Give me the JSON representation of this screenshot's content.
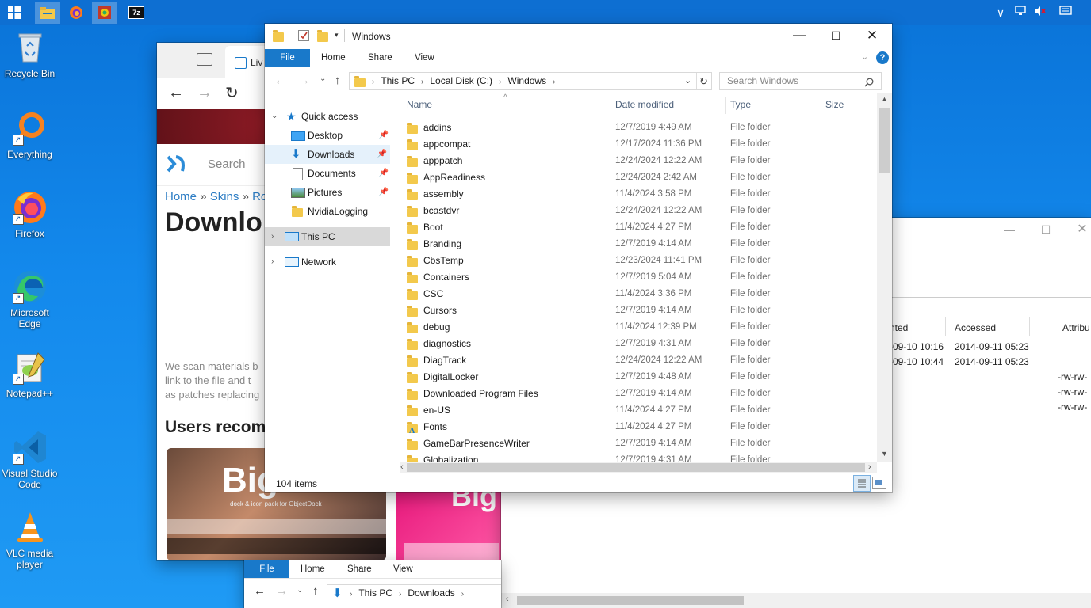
{
  "desktop_icons": [
    {
      "label": "Recycle Bin",
      "icon": "recycle-bin-icon"
    },
    {
      "label": "Everything",
      "icon": "everything-search-icon"
    },
    {
      "label": "Firefox",
      "icon": "firefox-icon"
    },
    {
      "label": "Microsoft Edge",
      "icon": "edge-icon"
    },
    {
      "label": "Notepad++",
      "icon": "notepadpp-icon"
    },
    {
      "label": "Visual Studio Code",
      "icon": "vscode-icon"
    },
    {
      "label": "VLC media player",
      "icon": "vlc-icon"
    }
  ],
  "taskbar": {
    "pinned": [
      "windows-start-icon",
      "file-explorer-icon",
      "firefox-icon",
      "app-icon",
      "7zip-icon"
    ],
    "zip_label": "7z"
  },
  "browser": {
    "tab_label": "Liv",
    "search_placeholder": "Search",
    "breadcrumb": {
      "home": "Home",
      "sep": "»",
      "skins": "Skins",
      "rest": "Ro"
    },
    "heading": "Downlo",
    "body_lines": [
      "We scan materials b",
      "link to the file and t",
      "as patches replacing"
    ],
    "users_heading": "Users recomn",
    "thumb_text_1": "Big",
    "thumb_text_2": "Big",
    "thumb_caption": "dock & icon pack for ObjectDock"
  },
  "explorer": {
    "title": "Windows",
    "ribbon": {
      "file": "File",
      "home": "Home",
      "share": "Share",
      "view": "View"
    },
    "address": [
      "This PC",
      "Local Disk (C:)",
      "Windows"
    ],
    "search_placeholder": "Search Windows",
    "nav": {
      "quick_access": "Quick access",
      "items": [
        {
          "label": "Desktop",
          "icon": "desktop-icon",
          "pinned": true
        },
        {
          "label": "Downloads",
          "icon": "downloads-icon",
          "pinned": true
        },
        {
          "label": "Documents",
          "icon": "documents-icon",
          "pinned": true
        },
        {
          "label": "Pictures",
          "icon": "pictures-icon",
          "pinned": true
        },
        {
          "label": "NvidiaLogging",
          "icon": "folder-icon",
          "pinned": false
        }
      ],
      "this_pc": "This PC",
      "network": "Network"
    },
    "columns": {
      "name": "Name",
      "date": "Date modified",
      "type": "Type",
      "size": "Size"
    },
    "files": [
      {
        "name": "addins",
        "date": "12/7/2019 4:49 AM",
        "type": "File folder"
      },
      {
        "name": "appcompat",
        "date": "12/17/2024 11:36 PM",
        "type": "File folder"
      },
      {
        "name": "apppatch",
        "date": "12/24/2024 12:22 AM",
        "type": "File folder"
      },
      {
        "name": "AppReadiness",
        "date": "12/24/2024 2:42 AM",
        "type": "File folder"
      },
      {
        "name": "assembly",
        "date": "11/4/2024 3:58 PM",
        "type": "File folder"
      },
      {
        "name": "bcastdvr",
        "date": "12/24/2024 12:22 AM",
        "type": "File folder"
      },
      {
        "name": "Boot",
        "date": "11/4/2024 4:27 PM",
        "type": "File folder"
      },
      {
        "name": "Branding",
        "date": "12/7/2019 4:14 AM",
        "type": "File folder"
      },
      {
        "name": "CbsTemp",
        "date": "12/23/2024 11:41 PM",
        "type": "File folder"
      },
      {
        "name": "Containers",
        "date": "12/7/2019 5:04 AM",
        "type": "File folder"
      },
      {
        "name": "CSC",
        "date": "11/4/2024 3:36 PM",
        "type": "File folder"
      },
      {
        "name": "Cursors",
        "date": "12/7/2019 4:14 AM",
        "type": "File folder"
      },
      {
        "name": "debug",
        "date": "11/4/2024 12:39 PM",
        "type": "File folder"
      },
      {
        "name": "diagnostics",
        "date": "12/7/2019 4:31 AM",
        "type": "File folder"
      },
      {
        "name": "DiagTrack",
        "date": "12/24/2024 12:22 AM",
        "type": "File folder"
      },
      {
        "name": "DigitalLocker",
        "date": "12/7/2019 4:48 AM",
        "type": "File folder"
      },
      {
        "name": "Downloaded Program Files",
        "date": "12/7/2019 4:14 AM",
        "type": "File folder"
      },
      {
        "name": "en-US",
        "date": "11/4/2024 4:27 PM",
        "type": "File folder"
      },
      {
        "name": "Fonts",
        "date": "11/4/2024 4:27 PM",
        "type": "File folder",
        "special": true
      },
      {
        "name": "GameBarPresenceWriter",
        "date": "12/7/2019 4:14 AM",
        "type": "File folder"
      },
      {
        "name": "Globalization",
        "date": "12/7/2019 4:31 AM",
        "type": "File folder"
      }
    ],
    "status": "104 items"
  },
  "right_window": {
    "col_created": "nted",
    "col_accessed": "Accessed",
    "col_attr": "Attribu",
    "rows": [
      {
        "created": "-09-10 10:16",
        "accessed": "2014-09-11 05:23",
        "attr": ""
      },
      {
        "created": "-09-10 10:44",
        "accessed": "2014-09-11 05:23",
        "attr": ""
      },
      {
        "created": "",
        "accessed": "",
        "attr": "-rw-rw-"
      },
      {
        "created": "",
        "accessed": "",
        "attr": "-rw-rw-"
      },
      {
        "created": "",
        "accessed": "",
        "attr": "-rw-rw-"
      }
    ]
  },
  "bottom_explorer": {
    "ribbon": {
      "file": "File",
      "home": "Home",
      "share": "Share",
      "view": "View"
    },
    "address": [
      "This PC",
      "Downloads"
    ]
  }
}
